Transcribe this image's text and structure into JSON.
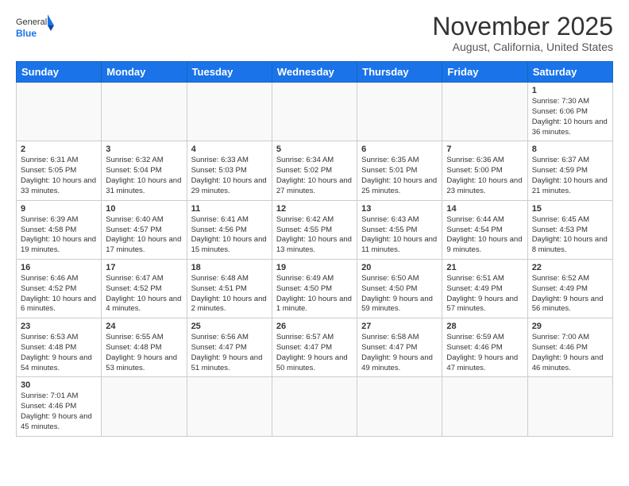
{
  "header": {
    "logo_general": "General",
    "logo_blue": "Blue",
    "month_title": "November 2025",
    "subtitle": "August, California, United States"
  },
  "weekdays": [
    "Sunday",
    "Monday",
    "Tuesday",
    "Wednesday",
    "Thursday",
    "Friday",
    "Saturday"
  ],
  "days": {
    "d1": {
      "num": "1",
      "sunrise": "7:30 AM",
      "sunset": "6:06 PM",
      "daylight": "10 hours and 36 minutes."
    },
    "d2": {
      "num": "2",
      "sunrise": "6:31 AM",
      "sunset": "5:05 PM",
      "daylight": "10 hours and 33 minutes."
    },
    "d3": {
      "num": "3",
      "sunrise": "6:32 AM",
      "sunset": "5:04 PM",
      "daylight": "10 hours and 31 minutes."
    },
    "d4": {
      "num": "4",
      "sunrise": "6:33 AM",
      "sunset": "5:03 PM",
      "daylight": "10 hours and 29 minutes."
    },
    "d5": {
      "num": "5",
      "sunrise": "6:34 AM",
      "sunset": "5:02 PM",
      "daylight": "10 hours and 27 minutes."
    },
    "d6": {
      "num": "6",
      "sunrise": "6:35 AM",
      "sunset": "5:01 PM",
      "daylight": "10 hours and 25 minutes."
    },
    "d7": {
      "num": "7",
      "sunrise": "6:36 AM",
      "sunset": "5:00 PM",
      "daylight": "10 hours and 23 minutes."
    },
    "d8": {
      "num": "8",
      "sunrise": "6:37 AM",
      "sunset": "4:59 PM",
      "daylight": "10 hours and 21 minutes."
    },
    "d9": {
      "num": "9",
      "sunrise": "6:39 AM",
      "sunset": "4:58 PM",
      "daylight": "10 hours and 19 minutes."
    },
    "d10": {
      "num": "10",
      "sunrise": "6:40 AM",
      "sunset": "4:57 PM",
      "daylight": "10 hours and 17 minutes."
    },
    "d11": {
      "num": "11",
      "sunrise": "6:41 AM",
      "sunset": "4:56 PM",
      "daylight": "10 hours and 15 minutes."
    },
    "d12": {
      "num": "12",
      "sunrise": "6:42 AM",
      "sunset": "4:55 PM",
      "daylight": "10 hours and 13 minutes."
    },
    "d13": {
      "num": "13",
      "sunrise": "6:43 AM",
      "sunset": "4:55 PM",
      "daylight": "10 hours and 11 minutes."
    },
    "d14": {
      "num": "14",
      "sunrise": "6:44 AM",
      "sunset": "4:54 PM",
      "daylight": "10 hours and 9 minutes."
    },
    "d15": {
      "num": "15",
      "sunrise": "6:45 AM",
      "sunset": "4:53 PM",
      "daylight": "10 hours and 8 minutes."
    },
    "d16": {
      "num": "16",
      "sunrise": "6:46 AM",
      "sunset": "4:52 PM",
      "daylight": "10 hours and 6 minutes."
    },
    "d17": {
      "num": "17",
      "sunrise": "6:47 AM",
      "sunset": "4:52 PM",
      "daylight": "10 hours and 4 minutes."
    },
    "d18": {
      "num": "18",
      "sunrise": "6:48 AM",
      "sunset": "4:51 PM",
      "daylight": "10 hours and 2 minutes."
    },
    "d19": {
      "num": "19",
      "sunrise": "6:49 AM",
      "sunset": "4:50 PM",
      "daylight": "10 hours and 1 minute."
    },
    "d20": {
      "num": "20",
      "sunrise": "6:50 AM",
      "sunset": "4:50 PM",
      "daylight": "9 hours and 59 minutes."
    },
    "d21": {
      "num": "21",
      "sunrise": "6:51 AM",
      "sunset": "4:49 PM",
      "daylight": "9 hours and 57 minutes."
    },
    "d22": {
      "num": "22",
      "sunrise": "6:52 AM",
      "sunset": "4:49 PM",
      "daylight": "9 hours and 56 minutes."
    },
    "d23": {
      "num": "23",
      "sunrise": "6:53 AM",
      "sunset": "4:48 PM",
      "daylight": "9 hours and 54 minutes."
    },
    "d24": {
      "num": "24",
      "sunrise": "6:55 AM",
      "sunset": "4:48 PM",
      "daylight": "9 hours and 53 minutes."
    },
    "d25": {
      "num": "25",
      "sunrise": "6:56 AM",
      "sunset": "4:47 PM",
      "daylight": "9 hours and 51 minutes."
    },
    "d26": {
      "num": "26",
      "sunrise": "6:57 AM",
      "sunset": "4:47 PM",
      "daylight": "9 hours and 50 minutes."
    },
    "d27": {
      "num": "27",
      "sunrise": "6:58 AM",
      "sunset": "4:47 PM",
      "daylight": "9 hours and 49 minutes."
    },
    "d28": {
      "num": "28",
      "sunrise": "6:59 AM",
      "sunset": "4:46 PM",
      "daylight": "9 hours and 47 minutes."
    },
    "d29": {
      "num": "29",
      "sunrise": "7:00 AM",
      "sunset": "4:46 PM",
      "daylight": "9 hours and 46 minutes."
    },
    "d30": {
      "num": "30",
      "sunrise": "7:01 AM",
      "sunset": "4:46 PM",
      "daylight": "9 hours and 45 minutes."
    }
  }
}
